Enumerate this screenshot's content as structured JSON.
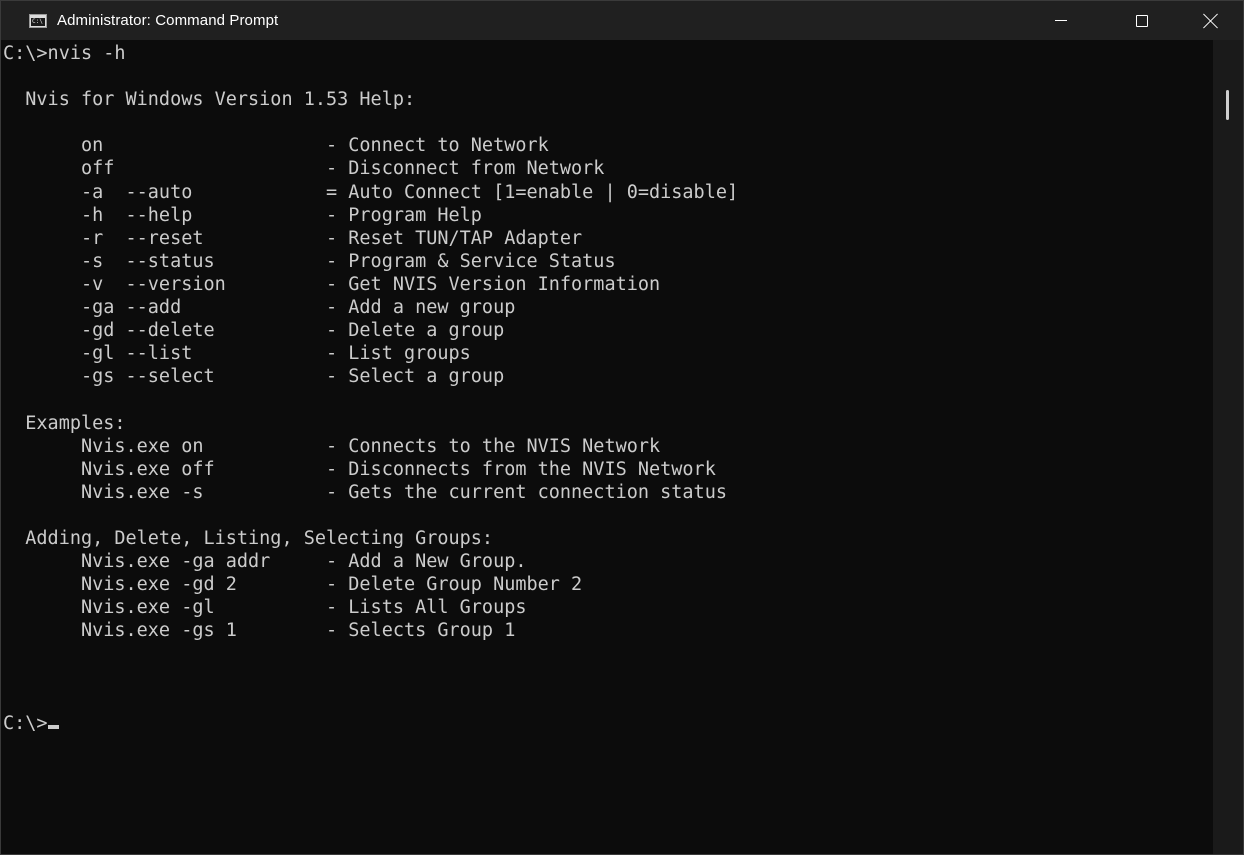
{
  "window": {
    "title": "Administrator: Command Prompt",
    "icon_text": "C:\\",
    "controls": {
      "minimize": "minimize-icon",
      "maximize": "maximize-icon",
      "close": "close-icon"
    }
  },
  "console": {
    "lines": [
      "C:\\>nvis -h",
      "",
      "  Nvis for Windows Version 1.53 Help:",
      "",
      "       on                    - Connect to Network",
      "       off                   - Disconnect from Network",
      "       -a  --auto            = Auto Connect [1=enable | 0=disable]",
      "       -h  --help            - Program Help",
      "       -r  --reset           - Reset TUN/TAP Adapter",
      "       -s  --status          - Program & Service Status",
      "       -v  --version         - Get NVIS Version Information",
      "       -ga --add             - Add a new group",
      "       -gd --delete          - Delete a group",
      "       -gl --list            - List groups",
      "       -gs --select          - Select a group",
      "",
      "  Examples:",
      "       Nvis.exe on           - Connects to the NVIS Network",
      "       Nvis.exe off          - Disconnects from the NVIS Network",
      "       Nvis.exe -s           - Gets the current connection status",
      "",
      "  Adding, Delete, Listing, Selecting Groups:",
      "       Nvis.exe -ga addr     - Add a New Group.",
      "       Nvis.exe -gd 2        - Delete Group Number 2",
      "       Nvis.exe -gl          - Lists All Groups",
      "       Nvis.exe -gs 1        - Selects Group 1",
      "",
      "",
      ""
    ],
    "prompt": "C:\\>"
  }
}
